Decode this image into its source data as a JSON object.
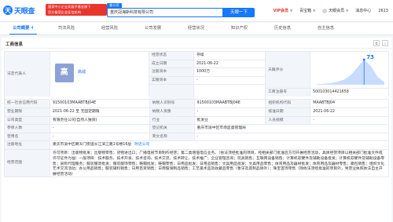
{
  "header": {
    "logo_text": "天眼查",
    "logo_mark": "天",
    "promo_line1": "国家中小企业发展子基金旗下",
    "promo_line2": "官方备案企业征信机构",
    "search_tab": "查公司",
    "search_value": "重庆冠海斯科技有限公司",
    "search_button": "天眼一下",
    "vip_label": "VIP会员",
    "service_label": "百宝箱",
    "app_label": "天眼会员",
    "msg_label": "消息中心",
    "count": "2613"
  },
  "tabs": [
    {
      "label": "公司概要",
      "badge": "4",
      "active": true
    },
    {
      "label": "司法风险",
      "badge": "",
      "active": false
    },
    {
      "label": "经营风险",
      "badge": "",
      "active": false
    },
    {
      "label": "公司发展",
      "badge": "",
      "active": false
    },
    {
      "label": "经营状况",
      "badge": "",
      "active": false
    },
    {
      "label": "知识产权",
      "badge": "",
      "active": false
    },
    {
      "label": "历史信息",
      "badge": "",
      "active": false
    },
    {
      "label": "自主信息",
      "badge": "",
      "active": false
    }
  ],
  "section": {
    "title": "工商信息"
  },
  "info": {
    "rep_label": "法定代表人",
    "rep_avatar": "高",
    "rep_name": "高城",
    "status_label": "经营状态",
    "status_value": "存续",
    "est_date_label": "成立日期",
    "est_date_value": "2021-06-22",
    "reg_cap_label": "注册资本",
    "reg_cap_value": "1000万",
    "paid_cap_label": "实缴资本",
    "paid_cap_value": "-",
    "tianyan_label": "天眼评分",
    "score_value": "73",
    "reg_no_label": "工商注册号",
    "reg_no_value": "500103014421658",
    "credit_code_label": "统一社会信用代码",
    "credit_code_value": "91500103MAABTBJ04E",
    "taxpayer_id_label": "纳税人识别号",
    "taxpayer_id_value": "91500103MAABTBJ04E",
    "org_code_label": "组织机构代码",
    "org_code_value": "MAABTBJ04",
    "term_label": "营业期限",
    "term_value": "2021-06-22 至 无固定期限",
    "taxpayer_qual_label": "纳税人资质",
    "taxpayer_qual_value": "-",
    "approve_label": "核准日期",
    "approve_value": "2021-06-22",
    "type_label": "公司类型",
    "type_value": "有限责任公司(自然人独资)",
    "industry_label": "行业",
    "industry_value": "批发业",
    "staff_label": "人员规模",
    "staff_value": "-",
    "insured_label": "参保人数",
    "insured_value": "-",
    "authority_label": "登记机关",
    "authority_value": "重庆市渝中区市场监督管理局",
    "former_label": "曾用名",
    "former_value": "-",
    "en_name_label": "英文名称",
    "en_name_value": "-",
    "address_label": "注册地址",
    "address_value": "重庆市渝中区朝天门街道长江滨江路1号楼16层",
    "address_link": "附近公司",
    "scope_label": "经营范围",
    "scope_value": "许可项目：出版物批发；出版物零售；货物进出口；广播电视节目制作经营；第二类增值电信业务。（依法须经批准的项目，经相关部门批准后方可开展经营活动，具体经营项目以相关部门批准文件或许可证件为准）一般项目：技术服务、技术开发、技术咨询、技术交流、技术转让、技术推广；企业管理咨询；玩具销售；互联网设备销售；计算机软硬件及辅助设备批发；计算机软硬件及辅助设备零售；采购代理服务；服装服饰批发；服装服饰零售；鞋帽批发；鞋帽零售；日用品批发；日用品销售；文具用品批发；文具用品零售；体育用品及器材批发；体育用品及器材零售；箱包销售；组织文化艺术交流活动；办公用品销售；服装辅料销售；日用百货销售；日用玻璃制品销售；工艺美术品及收藏品零售（象牙及其制品除外）；珠宝首饰零售（除依法须经批准的项目外，凭营业执照依法自主开展经营活动）"
  },
  "chart_data": {
    "type": "area",
    "title": "天眼评分",
    "score": 73,
    "x": [
      0,
      1,
      2,
      3,
      4,
      5,
      6,
      7,
      8,
      9,
      10
    ],
    "values": [
      2,
      3,
      5,
      9,
      16,
      30,
      55,
      80,
      60,
      25,
      8
    ],
    "marker_index": 7,
    "colors": {
      "fill": "#c9dcff",
      "marker": "#1677ff"
    }
  },
  "colors": {
    "accent": "#1677ff",
    "vip": "#e8362d"
  }
}
